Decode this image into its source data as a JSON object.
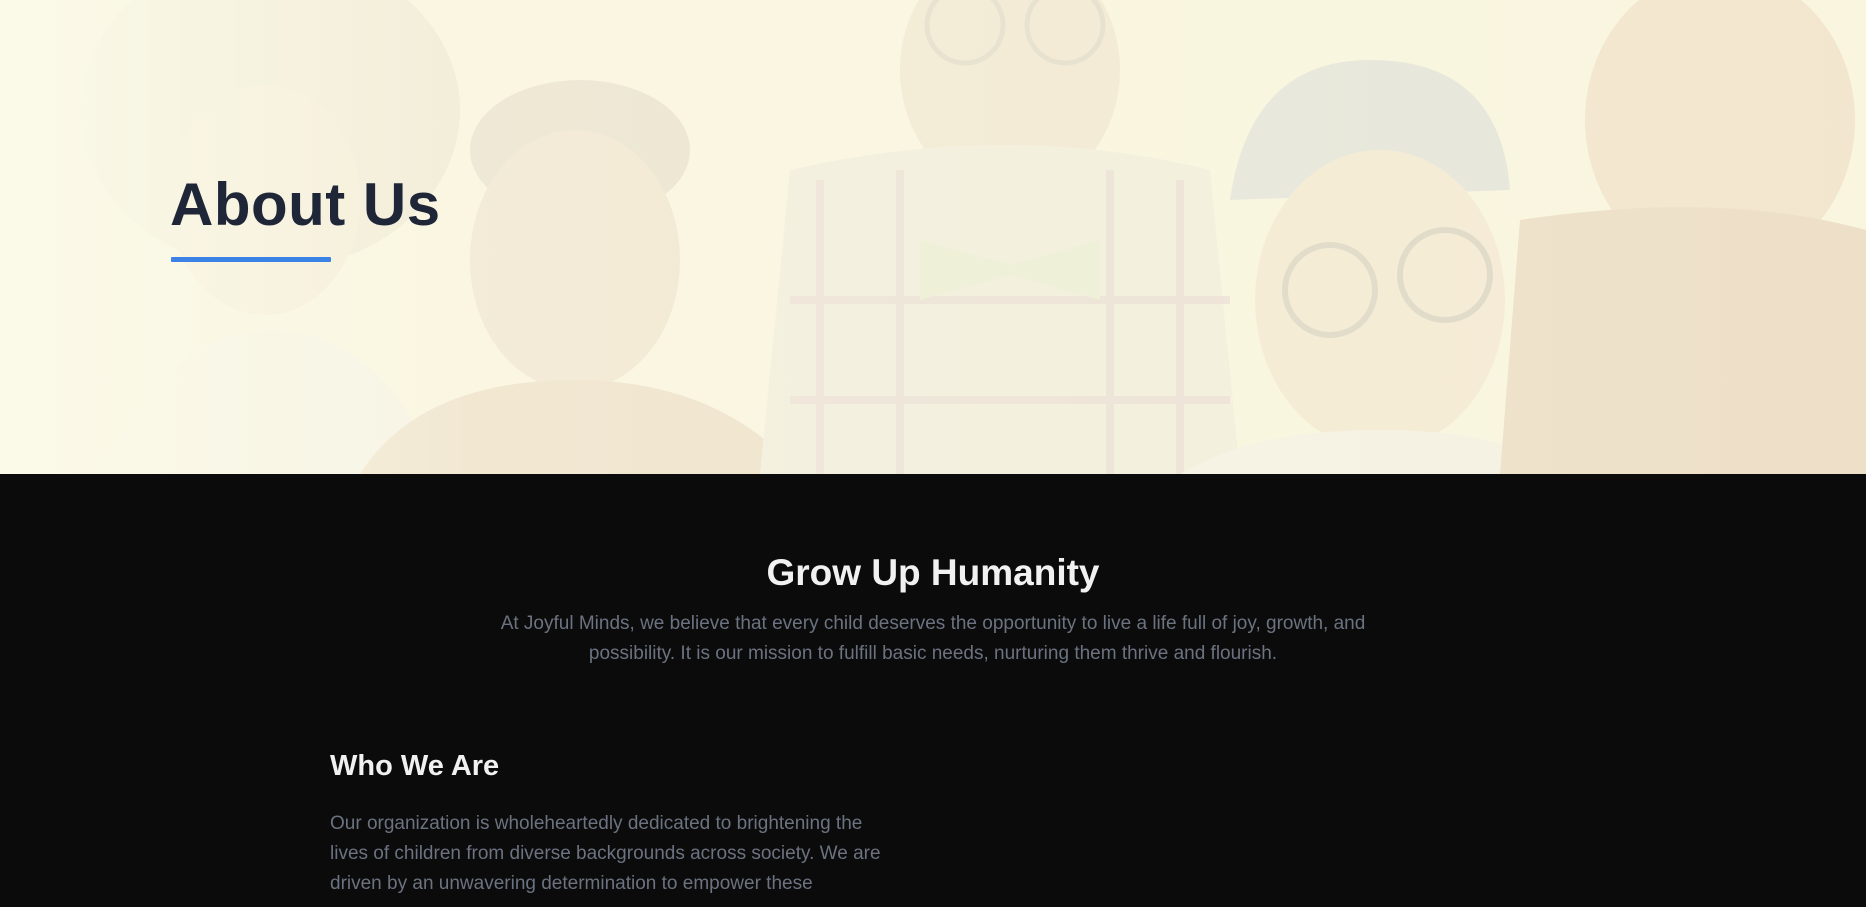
{
  "hero": {
    "title": "About Us",
    "accent_color": "#3b82e6",
    "background_image": "group-of-smiling-children-photo"
  },
  "mission": {
    "title": "Grow Up Humanity",
    "lead": "At Joyful Minds, we believe that every child deserves the opportunity to live a life full of joy, growth, and possibility. It is our mission to fulfill basic needs, nurturing them thrive and flourish."
  },
  "who_we_are": {
    "title": "Who We Are",
    "body": "Our organization is wholeheartedly dedicated to brightening the lives of children from diverse backgrounds across society. We are driven by an unwavering determination to empower these"
  },
  "colors": {
    "hero_bg": "#fbf9e8",
    "section_bg": "#0b0b0b",
    "heading_dark": "#1e2637",
    "heading_light": "#f1f1f1",
    "body_text": "#6b7280"
  }
}
